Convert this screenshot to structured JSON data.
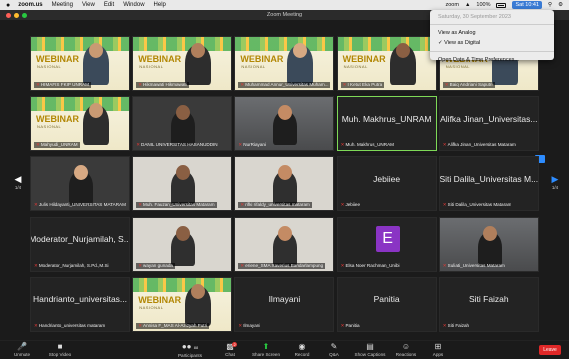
{
  "menubar": {
    "apple": "",
    "items": [
      "zoom.us",
      "Meeting",
      "View",
      "Edit",
      "Window",
      "Help"
    ],
    "right_app": "zoom",
    "battery": "100%",
    "clock": "Sat 10:41"
  },
  "window": {
    "title": "Zoom Meeting"
  },
  "clock_menu": {
    "date": "Saturday, 30 September 2023",
    "options": [
      "View as Analog",
      "✓ View as Digital",
      "Open Date & Time Preferences..."
    ]
  },
  "webinar": {
    "title": "WEBINAR",
    "subtitle": "NASIONAL"
  },
  "tiles": [
    {
      "label": "HIMAFIS FKIP UNRAM",
      "kind": "webinar"
    },
    {
      "label": "Hikmawati Hikmawati",
      "kind": "webinar"
    },
    {
      "label": "Muhammad Annur_Universitas Muham...",
      "kind": "webinar"
    },
    {
      "label": "I Ketut Eka Putra",
      "kind": "webinar"
    },
    {
      "label": "Baiq Andriani Saputri",
      "kind": "webinar"
    },
    {
      "label": "Mahyudi_UNRAM",
      "kind": "webinar"
    },
    {
      "label": "DANIL UNIVERSITAS HASANUDDIN",
      "kind": "dark"
    },
    {
      "label": "NurRiayani",
      "kind": "room"
    },
    {
      "name": "Muh. Makhrus_UNRAM",
      "label": "Muh. Makhrus_UNRAM",
      "kind": "name",
      "active": true
    },
    {
      "name": "Alifka Jinan_Universitas...",
      "label": "Alifka Jinan_Universitas Mataram",
      "kind": "name"
    },
    {
      "label": "Julis Hildayanti_UNIVERSITAS MATARAM",
      "kind": "dark"
    },
    {
      "label": "Muh. Fauzan_Universitas Mataram",
      "kind": "wall"
    },
    {
      "label": "rifki rifaldy_universitas mataram",
      "kind": "wall"
    },
    {
      "name": "Jebiiee",
      "label": "Jebiiee",
      "kind": "name"
    },
    {
      "name": "Siti Dalila_Universitas M...",
      "label": "Siti Dalila_Universitas Mataram",
      "kind": "name"
    },
    {
      "name": "Moderator_Nurjamilah, S...",
      "label": "Moderator_Nurjamilah, S.Pd.,M.Si",
      "kind": "name"
    },
    {
      "label": "wayan gunada",
      "kind": "wall"
    },
    {
      "label": "eriene_SMA Xaverius Bandarlampung",
      "kind": "wall"
    },
    {
      "label": "Elsa Noer Rachman_Unibi",
      "kind": "avatar",
      "letter": "E"
    },
    {
      "label": "Suliati_Universitas Mataram",
      "kind": "room"
    },
    {
      "name": "Handrianto_universitas...",
      "label": "Handrianto_universitas mataram",
      "kind": "name"
    },
    {
      "label": "Annisa F_MAS Al-Azizyah Putri",
      "kind": "webinar"
    },
    {
      "name": "Ilmayani",
      "label": "Ilmayani",
      "kind": "name"
    },
    {
      "name": "Panitia",
      "label": "Panitia",
      "kind": "name"
    },
    {
      "name": "Siti Faizah",
      "label": "Siti Faizah",
      "kind": "name"
    }
  ],
  "nav": {
    "left_page": "1/4",
    "right_page": "1/4"
  },
  "toolbar": {
    "items": [
      {
        "label": "Unmute",
        "icon": "mic-muted-icon"
      },
      {
        "label": "Stop Video",
        "icon": "video-icon"
      },
      {
        "label": "Participants",
        "icon": "participants-icon",
        "count": "88"
      },
      {
        "label": "Chat",
        "icon": "chat-icon",
        "badge": "2"
      },
      {
        "label": "Share Screen",
        "icon": "share-screen-icon"
      },
      {
        "label": "Record",
        "icon": "record-icon"
      },
      {
        "label": "Q&A",
        "icon": "qa-icon"
      },
      {
        "label": "Show Captions",
        "icon": "captions-icon"
      },
      {
        "label": "Reactions",
        "icon": "reactions-icon"
      },
      {
        "label": "Apps",
        "icon": "apps-icon"
      }
    ],
    "leave": "Leave"
  },
  "colors": {
    "accent": "#2d8cff",
    "active_border": "#7ed957",
    "leave": "#e02828",
    "muted_mic": "#e53935"
  }
}
